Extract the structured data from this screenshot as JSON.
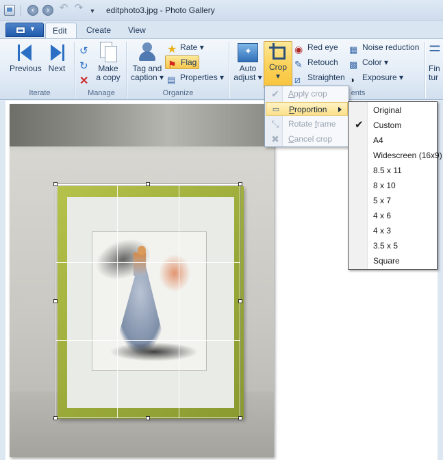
{
  "window": {
    "title": "editphoto3.jpg - Photo Gallery"
  },
  "tabs": [
    {
      "label": "Edit"
    },
    {
      "label": "Create"
    },
    {
      "label": "View"
    }
  ],
  "ribbon": {
    "iterate": {
      "label": "Iterate",
      "previous": "Previous",
      "next": "Next"
    },
    "manage": {
      "label": "Manage",
      "make_copy_line1": "Make",
      "make_copy_line2": "a copy"
    },
    "organize": {
      "label": "Organize",
      "tag_line1": "Tag and",
      "tag_line2": "caption",
      "rate": "Rate",
      "flag": "Flag",
      "properties": "Properties"
    },
    "adjustments": {
      "label_fragment": "ents",
      "auto_line1": "Auto",
      "auto_line2": "adjust",
      "crop": "Crop",
      "red_eye": "Red eye",
      "retouch": "Retouch",
      "straighten": "Straighten",
      "noise_reduction": "Noise reduction",
      "color": "Color",
      "exposure": "Exposure",
      "fine_tune_line1": "Fin",
      "fine_tune_line2": "tur"
    }
  },
  "crop_menu": {
    "apply_crop": {
      "pre": "",
      "underline": "A",
      "post": "pply crop"
    },
    "proportion": {
      "pre": "",
      "underline": "P",
      "post": "roportion"
    },
    "rotate_frame": {
      "pre": "Rotate ",
      "underline": "f",
      "post": "rame"
    },
    "cancel_crop": {
      "pre": "",
      "underline": "C",
      "post": "ancel crop"
    }
  },
  "proportion_menu": {
    "items": [
      "Original",
      "Custom",
      "A4",
      "Widescreen (16x9)",
      "8.5 x 11",
      "8 x 10",
      "5 x 7",
      "4 x 6",
      "4 x 3",
      "3.5 x 5",
      "Square"
    ],
    "selected": "Custom"
  },
  "colors": {
    "accent": "#2a6fc4",
    "pressed": "#fbd25a",
    "frame": "#98a838"
  }
}
